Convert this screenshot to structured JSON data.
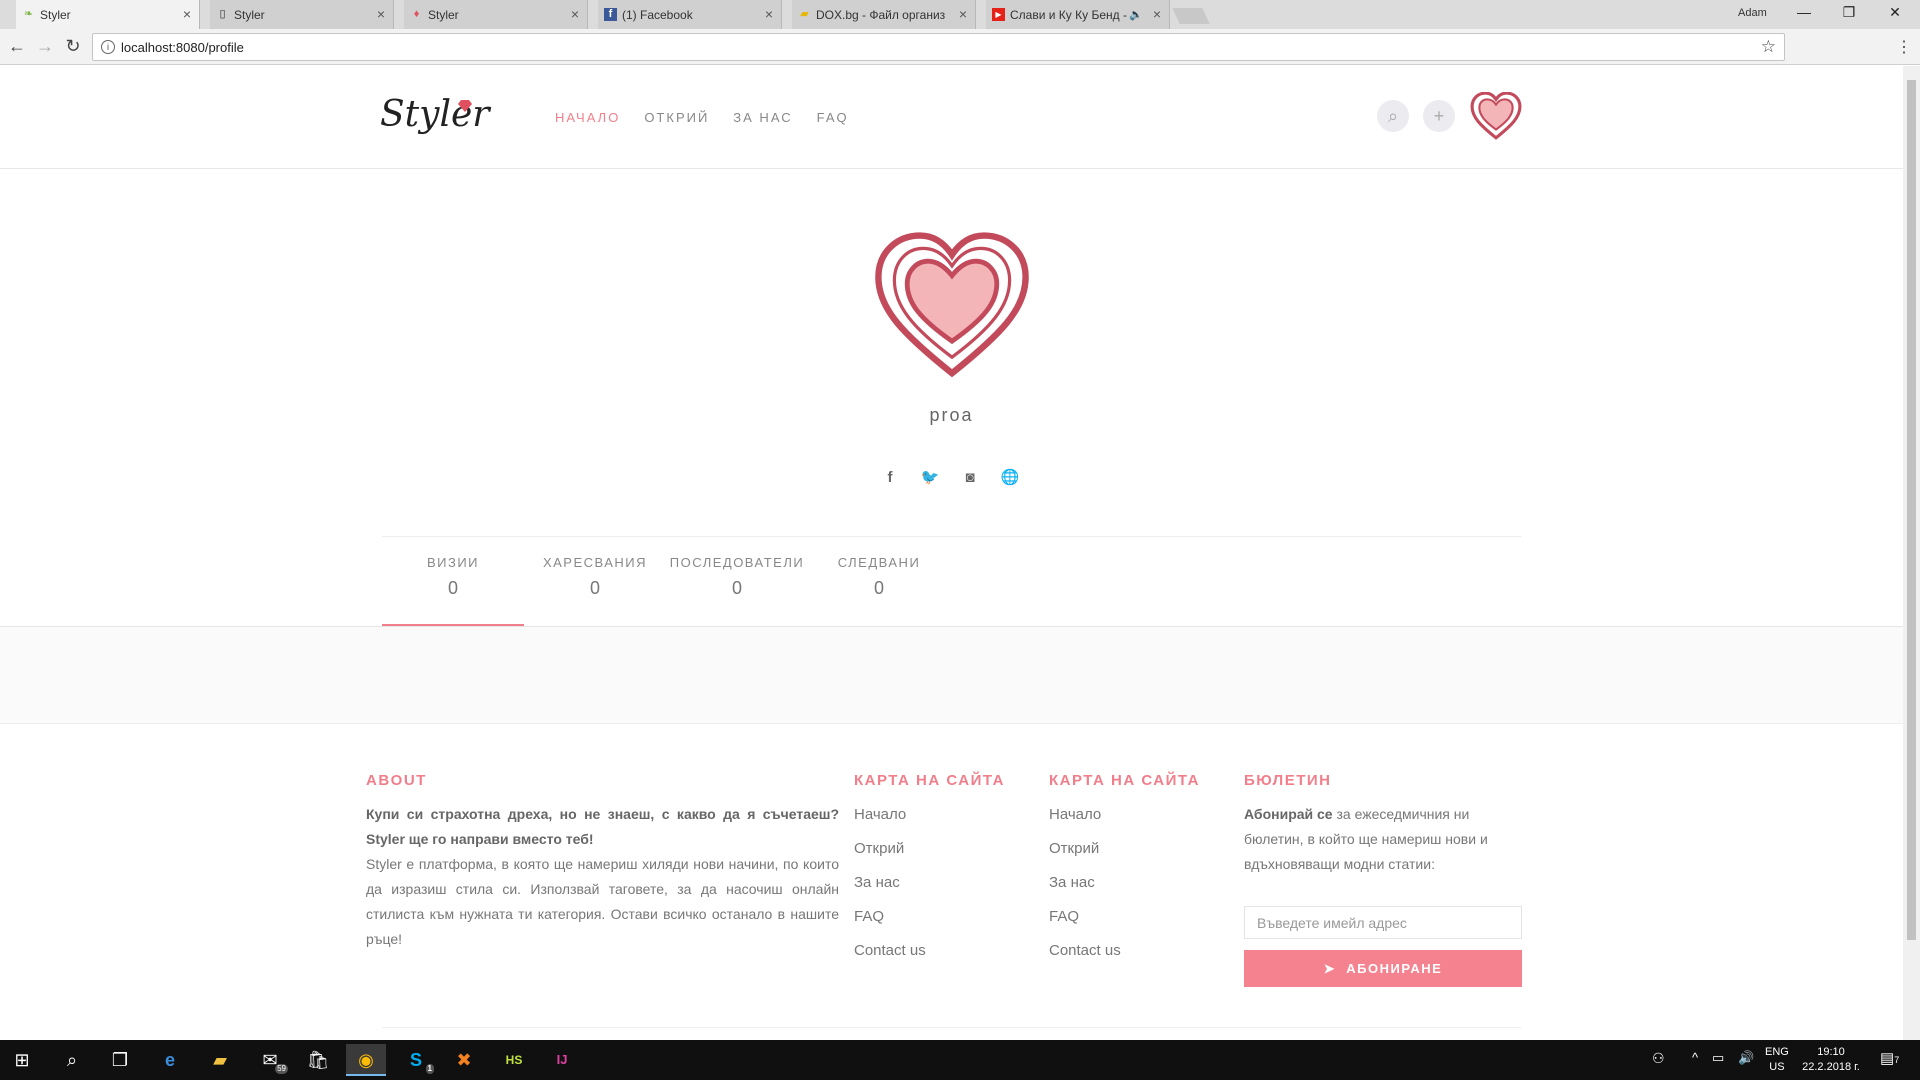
{
  "browser": {
    "tabs": [
      {
        "title": "Styler",
        "icon": "leaf-icon",
        "active": true
      },
      {
        "title": "Styler",
        "icon": "page-icon",
        "active": false
      },
      {
        "title": "Styler",
        "icon": "gem-icon",
        "active": false
      },
      {
        "title": "(1) Facebook",
        "icon": "facebook-icon",
        "active": false
      },
      {
        "title": "DOX.bg - Файл организ",
        "icon": "folder-icon",
        "active": false
      },
      {
        "title": "Слави и Ку Ку Бенд -",
        "icon": "youtube-icon",
        "active": false
      }
    ],
    "user": "Adam",
    "url": "localhost:8080/profile"
  },
  "header": {
    "logo": "Styler",
    "nav": [
      "НАЧАЛО",
      "ОТКРИЙ",
      "ЗА НАС",
      "FAQ"
    ]
  },
  "profile": {
    "username": "proa",
    "stats": [
      {
        "label": "ВИЗИИ",
        "value": "0"
      },
      {
        "label": "ХАРЕСВАНИЯ",
        "value": "0"
      },
      {
        "label": "ПОСЛЕДОВАТЕЛИ",
        "value": "0"
      },
      {
        "label": "СЛЕДВАНИ",
        "value": "0"
      }
    ]
  },
  "footer": {
    "about_title": "ABOUT",
    "about_bold": "Купи си страхотна дреха, но не знаеш, с какво да я съчетаеш? Styler ще го направи вместо теб!",
    "about_text": "Styler е платформа, в която ще намериш хиляди нови начини, по които да изразиш стила си. Използвай таговете, за да насочиш онлайн стилиста към нужната ти категория. Остави всичко останало в нашите ръце!",
    "sitemap_title": "КАРТА НА САЙТА",
    "sitemap_links": [
      "Начало",
      "Открий",
      "За нас",
      "FAQ",
      "Contact us"
    ],
    "sitemap2_title": "КАРТА НА САЙТА",
    "sitemap2_links": [
      "Начало",
      "Открий",
      "За нас",
      "FAQ",
      "Contact us"
    ],
    "newsletter_title": "БЮЛЕТИН",
    "newsletter_bold": "Абонирай се",
    "newsletter_text": " за ежеседмичния ни бюлетин, в който ще намериш нови и вдъхновяващи модни статии:",
    "email_placeholder": "Въведете имейл адрес",
    "subscribe_label": "АБОНИРАНЕ"
  },
  "taskbar": {
    "mail_badge": "59",
    "skype_badge": "1",
    "lang_top": "ENG",
    "lang_bottom": "US",
    "time": "19:10",
    "date": "22.2.2018 г.",
    "notif_badge": "7"
  },
  "colors": {
    "accent": "#f07f8b",
    "button": "#f5828f"
  }
}
